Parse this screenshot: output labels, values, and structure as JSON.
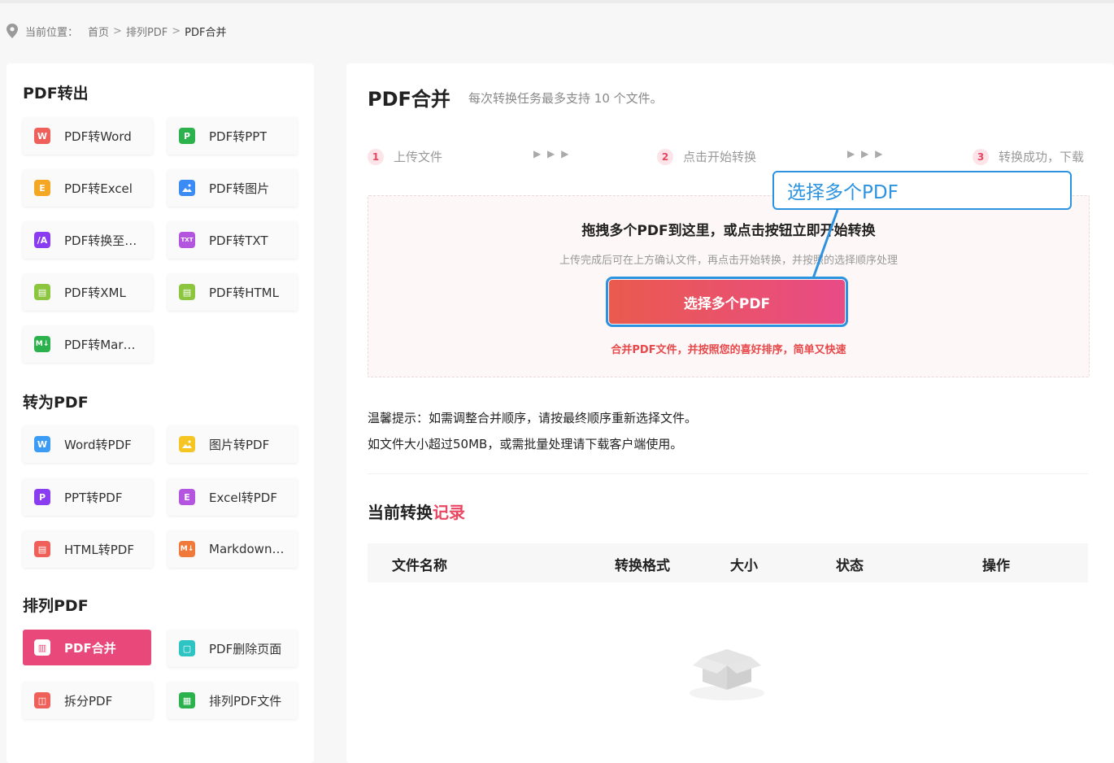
{
  "breadcrumb": {
    "label": "当前位置：",
    "items": [
      "首页",
      "排列PDF",
      "PDF合并"
    ],
    "separator": ">"
  },
  "sidebar": {
    "sections": [
      {
        "title": "PDF转出",
        "tools": [
          {
            "label": "PDF转Word",
            "icon": "W",
            "color": "#f0605a"
          },
          {
            "label": "PDF转PPT",
            "icon": "P",
            "color": "#2bb24c"
          },
          {
            "label": "PDF转Excel",
            "icon": "E",
            "color": "#f5a623"
          },
          {
            "label": "PDF转图片",
            "icon": "img",
            "color": "#3b8bf5"
          },
          {
            "label": "PDF转换至…",
            "icon": "/A",
            "color": "#8a3cf0"
          },
          {
            "label": "PDF转TXT",
            "icon": "TXT",
            "color": "#b455e0"
          },
          {
            "label": "PDF转XML",
            "icon": "▤",
            "color": "#8cc63f"
          },
          {
            "label": "PDF转HTML",
            "icon": "▤",
            "color": "#8cc63f"
          },
          {
            "label": "PDF转Mar…",
            "icon": "M↓",
            "color": "#2bb24c"
          }
        ]
      },
      {
        "title": "转为PDF",
        "tools": [
          {
            "label": "Word转PDF",
            "icon": "W",
            "color": "#3b9bf5"
          },
          {
            "label": "图片转PDF",
            "icon": "img",
            "color": "#f5c623"
          },
          {
            "label": "PPT转PDF",
            "icon": "P",
            "color": "#8a3cf0"
          },
          {
            "label": "Excel转PDF",
            "icon": "E",
            "color": "#b455e0"
          },
          {
            "label": "HTML转PDF",
            "icon": "▤",
            "color": "#f0605a"
          },
          {
            "label": "Markdown…",
            "icon": "M↓",
            "color": "#f07a3a"
          }
        ]
      },
      {
        "title": "排列PDF",
        "tools": [
          {
            "label": "PDF合并",
            "icon": "▥",
            "color": "#e8487a",
            "active": true
          },
          {
            "label": "PDF删除页面",
            "icon": "▢",
            "color": "#2ec4c4"
          },
          {
            "label": "拆分PDF",
            "icon": "◫",
            "color": "#f0605a"
          },
          {
            "label": "排列PDF文件",
            "icon": "▦",
            "color": "#2bb24c"
          }
        ]
      }
    ]
  },
  "main": {
    "title": "PDF合并",
    "subtitle": "每次转换任务最多支持 10 个文件。",
    "steps": [
      {
        "num": "1",
        "label": "上传文件"
      },
      {
        "num": "2",
        "label": "点击开始转换"
      },
      {
        "num": "3",
        "label": "转换成功，下载"
      }
    ],
    "step_arrows": "▶ ▶ ▶",
    "dropzone": {
      "title": "拖拽多个PDF到这里，或点击按钮立即开始转换",
      "desc": "上传完成后可在上方确认文件，再点击开始转换，并按照的选择顺序处理",
      "button": "选择多个PDF",
      "tip": "合并PDF文件，并按照您的喜好排序，简单又快速"
    },
    "notes": [
      "温馨提示：如需调整合并顺序，请按最终顺序重新选择文件。",
      "如文件大小超过50MB，或需批量处理请下载客户端使用。"
    ],
    "records": {
      "title_a": "当前转换",
      "title_b": "记录",
      "columns": [
        "文件名称",
        "转换格式",
        "大小",
        "状态",
        "操作"
      ]
    }
  },
  "annotation": {
    "text": "选择多个PDF",
    "color": "#2b93e0"
  }
}
